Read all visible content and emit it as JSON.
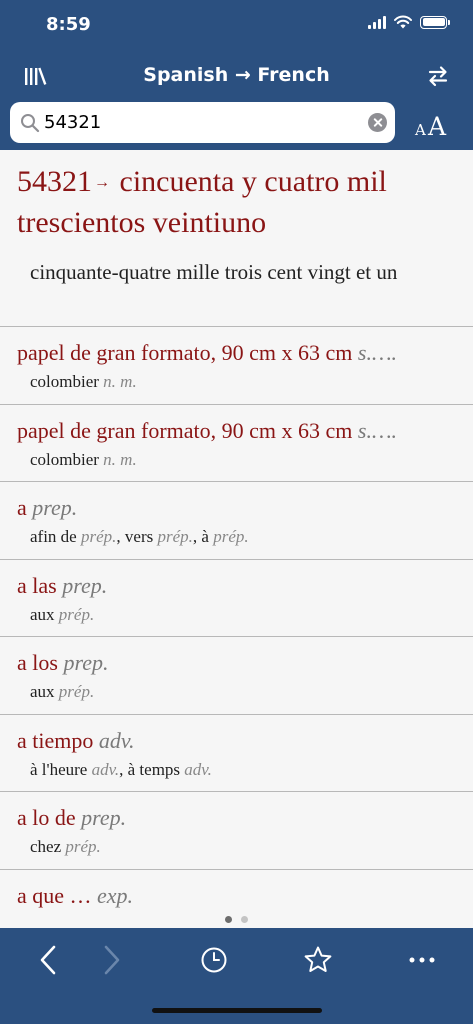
{
  "status": {
    "time": "8:59"
  },
  "nav": {
    "title": "Spanish → French"
  },
  "search": {
    "value": "54321"
  },
  "font_size": {
    "small": "A",
    "big": "A"
  },
  "main_entry": {
    "headword": "54321",
    "arrow": "→",
    "translation_es": "cincuenta y cuatro mil trescientos veintiuno",
    "translation_fr": "cinquante-quatre mille trois cent vingt et un"
  },
  "items": [
    {
      "head": "papel de gran formato, 90 cm x 63 cm",
      "head_pos": "s.….",
      "subs": [
        {
          "word": "colombier",
          "pos": "n. m."
        }
      ]
    },
    {
      "head": "papel de gran formato, 90 cm x 63 cm",
      "head_pos": "s.….",
      "subs": [
        {
          "word": "colombier",
          "pos": "n. m."
        }
      ]
    },
    {
      "head": "a",
      "head_pos": "prep.",
      "subs": [
        {
          "word": "afin de",
          "pos": "prép."
        },
        {
          "word": "vers",
          "pos": "prép."
        },
        {
          "word": "à",
          "pos": "prép."
        }
      ]
    },
    {
      "head": "a las",
      "head_pos": "prep.",
      "subs": [
        {
          "word": "aux",
          "pos": "prép."
        }
      ]
    },
    {
      "head": "a los",
      "head_pos": "prep.",
      "subs": [
        {
          "word": "aux",
          "pos": "prép."
        }
      ]
    },
    {
      "head": "a tiempo",
      "head_pos": "adv.",
      "subs": [
        {
          "word": "à l'heure",
          "pos": "adv."
        },
        {
          "word": "à temps",
          "pos": "adv."
        }
      ]
    },
    {
      "head": "a lo de",
      "head_pos": "prep.",
      "subs": [
        {
          "word": "chez",
          "pos": "prép."
        }
      ]
    },
    {
      "head": "a que …",
      "head_pos": "exp.",
      "subs": []
    }
  ],
  "colors": {
    "bar": "#2b5080",
    "headword": "#8a1515",
    "background": "#f6f6f6"
  }
}
